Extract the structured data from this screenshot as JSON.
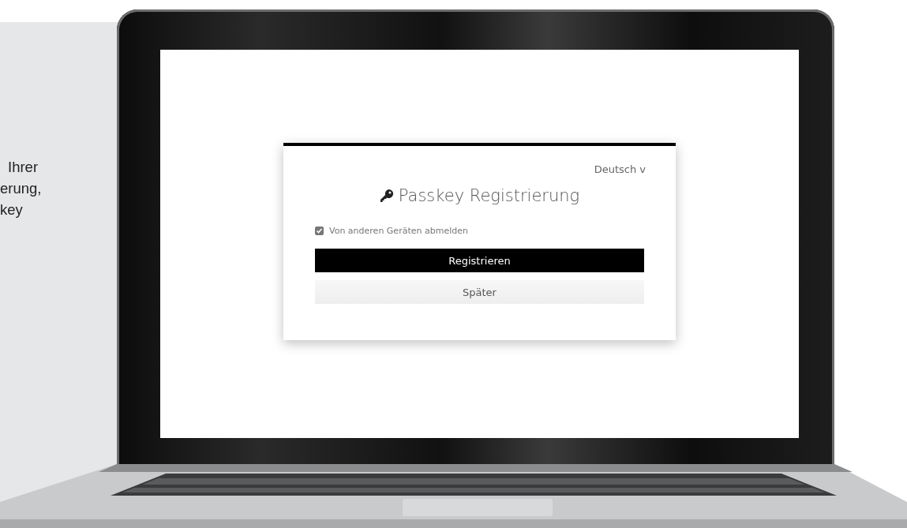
{
  "intro_text": {
    "lines": [
      "Ihrer",
      "erung,",
      "key"
    ]
  },
  "login_card": {
    "language": "Deutsch",
    "language_caret": "v",
    "title": "Passkey Registrierung",
    "checkbox": {
      "label": "Von anderen Geräten abmelden",
      "checked": true
    },
    "buttons": [
      {
        "label": "Registrieren",
        "kind": "primary"
      },
      {
        "label": "Später",
        "kind": "secondary"
      }
    ]
  }
}
